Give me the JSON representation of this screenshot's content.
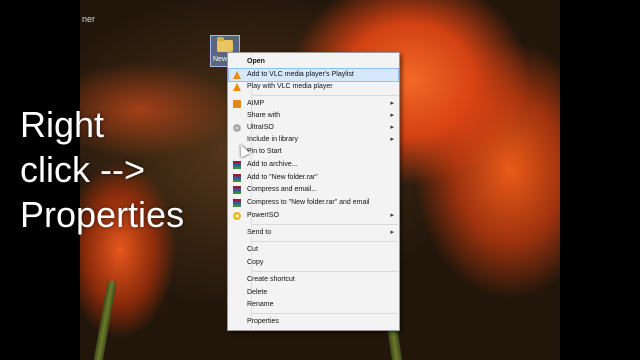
{
  "overlay": {
    "line1": "Right",
    "line2": "click -->",
    "line3": "Properties"
  },
  "desktop": {
    "corner_text": "ner",
    "icon_label": "New"
  },
  "menu": {
    "items": [
      {
        "label": "Open",
        "bold": true
      },
      {
        "label": "Add to VLC media player's Playlist",
        "icon": "vlc-icon",
        "highlighted": true
      },
      {
        "label": "Play with VLC media player",
        "icon": "vlc-icon"
      },
      {
        "label": "AIMP",
        "icon": "aimp-icon",
        "submenu": true
      },
      {
        "label": "Share with",
        "submenu": true
      },
      {
        "label": "UltraISO",
        "icon": "ultraiso-icon",
        "submenu": true
      },
      {
        "label": "Include in library",
        "submenu": true
      },
      {
        "label": "Pin to Start"
      },
      {
        "label": "Add to archive...",
        "icon": "winrar-icon"
      },
      {
        "label": "Add to \"New folder.rar\"",
        "icon": "winrar-icon"
      },
      {
        "label": "Compress and email...",
        "icon": "winrar-icon"
      },
      {
        "label": "Compress to \"New folder.rar\" and email",
        "icon": "winrar-icon"
      },
      {
        "label": "PowerISO",
        "icon": "poweriso-icon",
        "submenu": true
      },
      {
        "label": "Send to",
        "submenu": true
      },
      {
        "label": "Cut"
      },
      {
        "label": "Copy"
      },
      {
        "label": "Create shortcut"
      },
      {
        "label": "Delete"
      },
      {
        "label": "Rename"
      },
      {
        "label": "Properties"
      }
    ],
    "submenu_arrow": "▸"
  }
}
